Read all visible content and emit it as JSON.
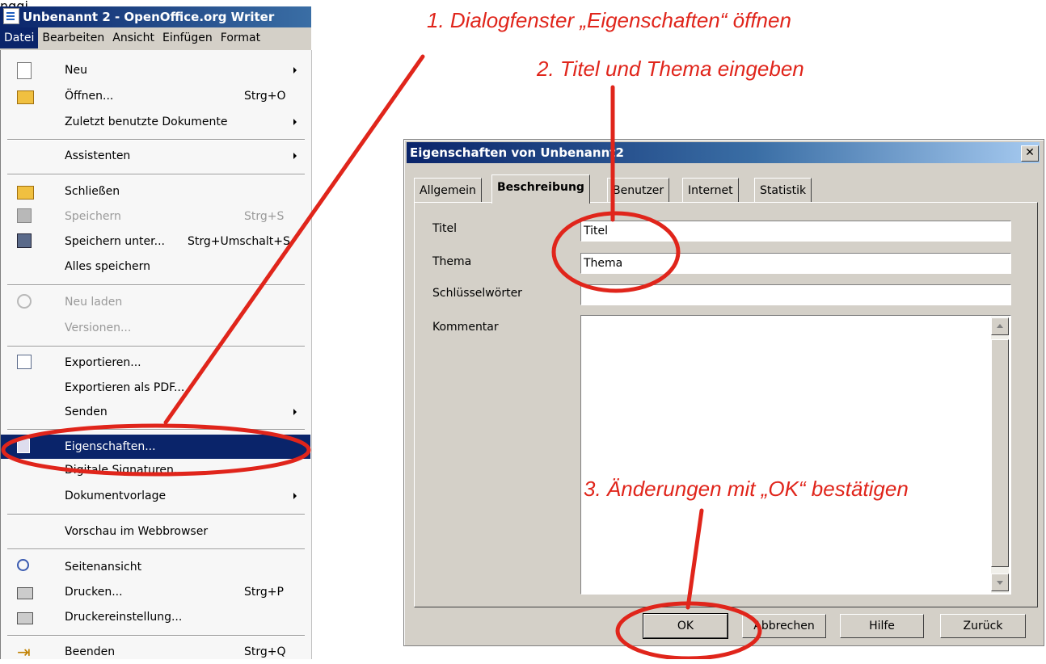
{
  "writer": {
    "top_fragment": "nggi",
    "title": "Unbenannt 2 - OpenOffice.org Writer",
    "menubar": [
      "Datei",
      "Bearbeiten",
      "Ansicht",
      "Einfügen",
      "Format"
    ]
  },
  "menu": {
    "items": [
      {
        "label": "Neu",
        "shortcut": "",
        "icon": "new-document-icon"
      },
      {
        "label": "Öffnen...",
        "shortcut": "Strg+O",
        "icon": "open-folder-icon"
      },
      {
        "label": "Zuletzt benutzte Dokumente",
        "shortcut": ""
      },
      {
        "label": "Assistenten",
        "shortcut": ""
      },
      {
        "label": "Schließen",
        "shortcut": "",
        "icon": "close-document-icon"
      },
      {
        "label": "Speichern",
        "shortcut": "Strg+S",
        "icon": "save-disk-icon"
      },
      {
        "label": "Speichern unter...",
        "shortcut": "Strg+Umschalt+S",
        "icon": "save-as-disk-icon"
      },
      {
        "label": "Alles speichern",
        "shortcut": ""
      },
      {
        "label": "Neu laden",
        "shortcut": "",
        "icon": "reload-icon"
      },
      {
        "label": "Versionen...",
        "shortcut": ""
      },
      {
        "label": "Exportieren...",
        "shortcut": "",
        "icon": "export-icon"
      },
      {
        "label": "Exportieren als PDF...",
        "shortcut": ""
      },
      {
        "label": "Senden",
        "shortcut": ""
      },
      {
        "label": "Eigenschaften...",
        "shortcut": "",
        "icon": "properties-icon"
      },
      {
        "label": "Digitale Signaturen...",
        "shortcut": ""
      },
      {
        "label": "Dokumentvorlage",
        "shortcut": ""
      },
      {
        "label": "Vorschau im Webbrowser",
        "shortcut": ""
      },
      {
        "label": "Seitenansicht",
        "shortcut": "",
        "icon": "page-preview-icon"
      },
      {
        "label": "Drucken...",
        "shortcut": "Strg+P",
        "icon": "printer-icon"
      },
      {
        "label": "Druckereinstellung...",
        "shortcut": "",
        "icon": "printer-settings-icon"
      },
      {
        "label": "Beenden",
        "shortcut": "Strg+Q",
        "icon": "exit-icon"
      }
    ]
  },
  "dialog": {
    "title": "Eigenschaften von Unbenannt2",
    "close_glyph": "✕",
    "tabs": [
      "Allgemein",
      "Beschreibung",
      "Benutzer",
      "Internet",
      "Statistik"
    ],
    "active_tab": "Beschreibung",
    "fields": {
      "title_label": "Titel",
      "title_value": "Titel",
      "theme_label": "Thema",
      "theme_value": "Thema",
      "keywords_label": "Schlüsselwörter",
      "keywords_value": "",
      "comment_label": "Kommentar",
      "comment_value": ""
    },
    "buttons": {
      "ok": "OK",
      "cancel": "Abbrechen",
      "help": "Hilfe",
      "back": "Zurück"
    }
  },
  "annotations": {
    "step1": "1. Dialogfenster „Eigenschaften“ öffnen",
    "step2": "2. Titel und Thema eingeben",
    "step3": "3. Änderungen mit „OK“ bestätigen",
    "color": "#e0251b"
  }
}
